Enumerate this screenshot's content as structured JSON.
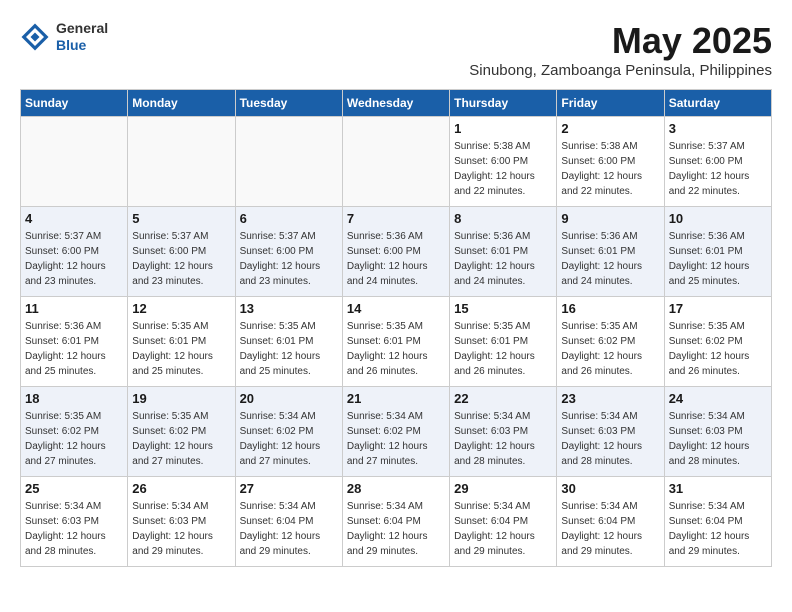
{
  "header": {
    "logo_general": "General",
    "logo_blue": "Blue",
    "month_title": "May 2025",
    "location": "Sinubong, Zamboanga Peninsula, Philippines"
  },
  "calendar": {
    "days_of_week": [
      "Sunday",
      "Monday",
      "Tuesday",
      "Wednesday",
      "Thursday",
      "Friday",
      "Saturday"
    ],
    "weeks": [
      [
        {
          "day": "",
          "info": ""
        },
        {
          "day": "",
          "info": ""
        },
        {
          "day": "",
          "info": ""
        },
        {
          "day": "",
          "info": ""
        },
        {
          "day": "1",
          "info": "Sunrise: 5:38 AM\nSunset: 6:00 PM\nDaylight: 12 hours\nand 22 minutes."
        },
        {
          "day": "2",
          "info": "Sunrise: 5:38 AM\nSunset: 6:00 PM\nDaylight: 12 hours\nand 22 minutes."
        },
        {
          "day": "3",
          "info": "Sunrise: 5:37 AM\nSunset: 6:00 PM\nDaylight: 12 hours\nand 22 minutes."
        }
      ],
      [
        {
          "day": "4",
          "info": "Sunrise: 5:37 AM\nSunset: 6:00 PM\nDaylight: 12 hours\nand 23 minutes."
        },
        {
          "day": "5",
          "info": "Sunrise: 5:37 AM\nSunset: 6:00 PM\nDaylight: 12 hours\nand 23 minutes."
        },
        {
          "day": "6",
          "info": "Sunrise: 5:37 AM\nSunset: 6:00 PM\nDaylight: 12 hours\nand 23 minutes."
        },
        {
          "day": "7",
          "info": "Sunrise: 5:36 AM\nSunset: 6:00 PM\nDaylight: 12 hours\nand 24 minutes."
        },
        {
          "day": "8",
          "info": "Sunrise: 5:36 AM\nSunset: 6:01 PM\nDaylight: 12 hours\nand 24 minutes."
        },
        {
          "day": "9",
          "info": "Sunrise: 5:36 AM\nSunset: 6:01 PM\nDaylight: 12 hours\nand 24 minutes."
        },
        {
          "day": "10",
          "info": "Sunrise: 5:36 AM\nSunset: 6:01 PM\nDaylight: 12 hours\nand 25 minutes."
        }
      ],
      [
        {
          "day": "11",
          "info": "Sunrise: 5:36 AM\nSunset: 6:01 PM\nDaylight: 12 hours\nand 25 minutes."
        },
        {
          "day": "12",
          "info": "Sunrise: 5:35 AM\nSunset: 6:01 PM\nDaylight: 12 hours\nand 25 minutes."
        },
        {
          "day": "13",
          "info": "Sunrise: 5:35 AM\nSunset: 6:01 PM\nDaylight: 12 hours\nand 25 minutes."
        },
        {
          "day": "14",
          "info": "Sunrise: 5:35 AM\nSunset: 6:01 PM\nDaylight: 12 hours\nand 26 minutes."
        },
        {
          "day": "15",
          "info": "Sunrise: 5:35 AM\nSunset: 6:01 PM\nDaylight: 12 hours\nand 26 minutes."
        },
        {
          "day": "16",
          "info": "Sunrise: 5:35 AM\nSunset: 6:02 PM\nDaylight: 12 hours\nand 26 minutes."
        },
        {
          "day": "17",
          "info": "Sunrise: 5:35 AM\nSunset: 6:02 PM\nDaylight: 12 hours\nand 26 minutes."
        }
      ],
      [
        {
          "day": "18",
          "info": "Sunrise: 5:35 AM\nSunset: 6:02 PM\nDaylight: 12 hours\nand 27 minutes."
        },
        {
          "day": "19",
          "info": "Sunrise: 5:35 AM\nSunset: 6:02 PM\nDaylight: 12 hours\nand 27 minutes."
        },
        {
          "day": "20",
          "info": "Sunrise: 5:34 AM\nSunset: 6:02 PM\nDaylight: 12 hours\nand 27 minutes."
        },
        {
          "day": "21",
          "info": "Sunrise: 5:34 AM\nSunset: 6:02 PM\nDaylight: 12 hours\nand 27 minutes."
        },
        {
          "day": "22",
          "info": "Sunrise: 5:34 AM\nSunset: 6:03 PM\nDaylight: 12 hours\nand 28 minutes."
        },
        {
          "day": "23",
          "info": "Sunrise: 5:34 AM\nSunset: 6:03 PM\nDaylight: 12 hours\nand 28 minutes."
        },
        {
          "day": "24",
          "info": "Sunrise: 5:34 AM\nSunset: 6:03 PM\nDaylight: 12 hours\nand 28 minutes."
        }
      ],
      [
        {
          "day": "25",
          "info": "Sunrise: 5:34 AM\nSunset: 6:03 PM\nDaylight: 12 hours\nand 28 minutes."
        },
        {
          "day": "26",
          "info": "Sunrise: 5:34 AM\nSunset: 6:03 PM\nDaylight: 12 hours\nand 29 minutes."
        },
        {
          "day": "27",
          "info": "Sunrise: 5:34 AM\nSunset: 6:04 PM\nDaylight: 12 hours\nand 29 minutes."
        },
        {
          "day": "28",
          "info": "Sunrise: 5:34 AM\nSunset: 6:04 PM\nDaylight: 12 hours\nand 29 minutes."
        },
        {
          "day": "29",
          "info": "Sunrise: 5:34 AM\nSunset: 6:04 PM\nDaylight: 12 hours\nand 29 minutes."
        },
        {
          "day": "30",
          "info": "Sunrise: 5:34 AM\nSunset: 6:04 PM\nDaylight: 12 hours\nand 29 minutes."
        },
        {
          "day": "31",
          "info": "Sunrise: 5:34 AM\nSunset: 6:04 PM\nDaylight: 12 hours\nand 29 minutes."
        }
      ]
    ]
  }
}
